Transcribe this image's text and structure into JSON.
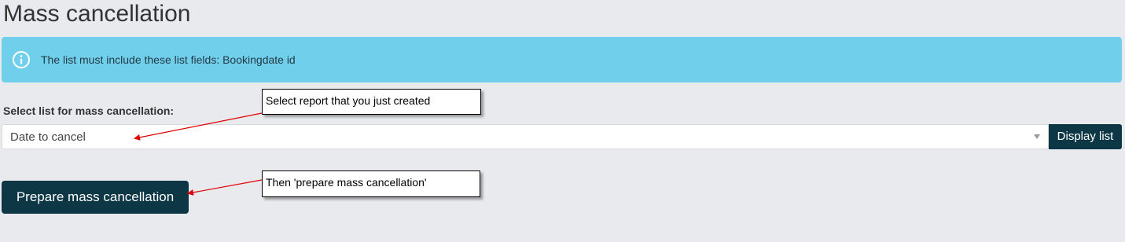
{
  "page": {
    "title": "Mass cancellation"
  },
  "alert": {
    "icon": "info-icon",
    "text": "The list must include these list fields: Bookingdate id",
    "background_color": "#70cfeb"
  },
  "list_selector": {
    "label": "Select list for mass cancellation:",
    "selected_value": "Date to cancel",
    "display_button_label": "Display list"
  },
  "actions": {
    "prepare_label": "Prepare mass cancellation",
    "button_color": "#0e3745"
  },
  "annotations": {
    "select_report_note": "Select report that you just created",
    "prepare_note": "Then 'prepare mass cancellation'",
    "arrow_color": "#e00000"
  }
}
